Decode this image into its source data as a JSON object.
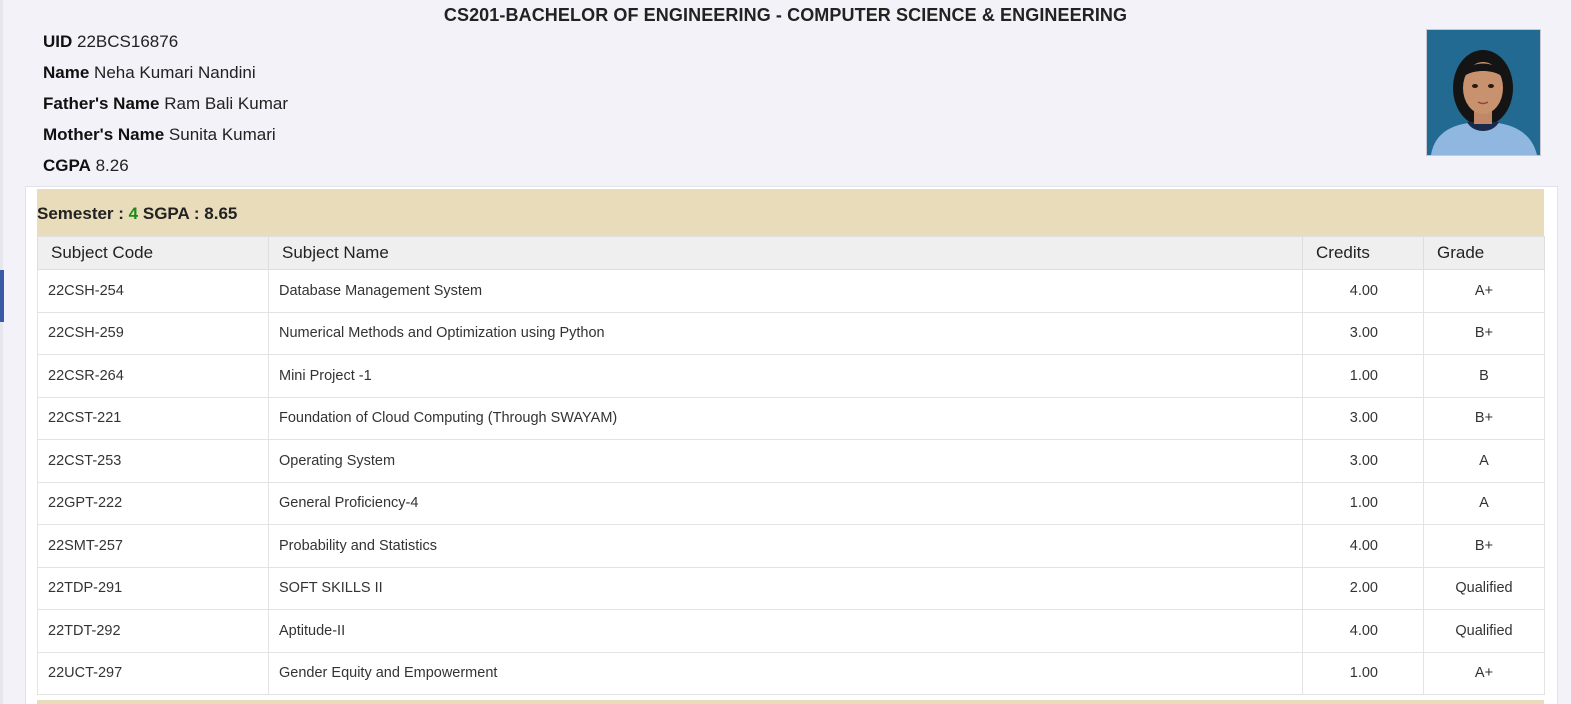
{
  "program": {
    "title": "CS201-BACHELOR OF ENGINEERING - COMPUTER SCIENCE & ENGINEERING"
  },
  "student": {
    "uid_label": "UID",
    "uid": "22BCS16876",
    "name_label": "Name",
    "name": "Neha Kumari Nandini",
    "father_label": "Father's Name",
    "father": "Ram Bali Kumar",
    "mother_label": "Mother's Name",
    "mother": "Sunita Kumari",
    "cgpa_label": "CGPA",
    "cgpa": "8.26"
  },
  "semester": {
    "label": "Semester :",
    "number": "4",
    "sgpa_label": "SGPA :",
    "sgpa": "8.65"
  },
  "table": {
    "headers": [
      "Subject Code",
      "Subject Name",
      "Credits",
      "Grade"
    ],
    "rows": [
      {
        "code": "22CSH-254",
        "name": "Database Management System",
        "credits": "4.00",
        "grade": "A+"
      },
      {
        "code": "22CSH-259",
        "name": "Numerical Methods and Optimization using Python",
        "credits": "3.00",
        "grade": "B+"
      },
      {
        "code": "22CSR-264",
        "name": "Mini Project -1",
        "credits": "1.00",
        "grade": "B"
      },
      {
        "code": "22CST-221",
        "name": "Foundation of Cloud Computing (Through SWAYAM)",
        "credits": "3.00",
        "grade": "B+"
      },
      {
        "code": "22CST-253",
        "name": "Operating System",
        "credits": "3.00",
        "grade": "A"
      },
      {
        "code": "22GPT-222",
        "name": "General Proficiency-4",
        "credits": "1.00",
        "grade": "A"
      },
      {
        "code": "22SMT-257",
        "name": "Probability and Statistics",
        "credits": "4.00",
        "grade": "B+"
      },
      {
        "code": "22TDP-291",
        "name": "SOFT SKILLS II",
        "credits": "2.00",
        "grade": "Qualified"
      },
      {
        "code": "22TDT-292",
        "name": "Aptitude-II",
        "credits": "4.00",
        "grade": "Qualified"
      },
      {
        "code": "22UCT-297",
        "name": "Gender Equity and Empowerment",
        "credits": "1.00",
        "grade": "A+"
      }
    ]
  },
  "colors": {
    "semester_header_bg": "#e8dcbb",
    "semester_number": "#1a8c1a",
    "page_bg": "#f2f2f8"
  }
}
